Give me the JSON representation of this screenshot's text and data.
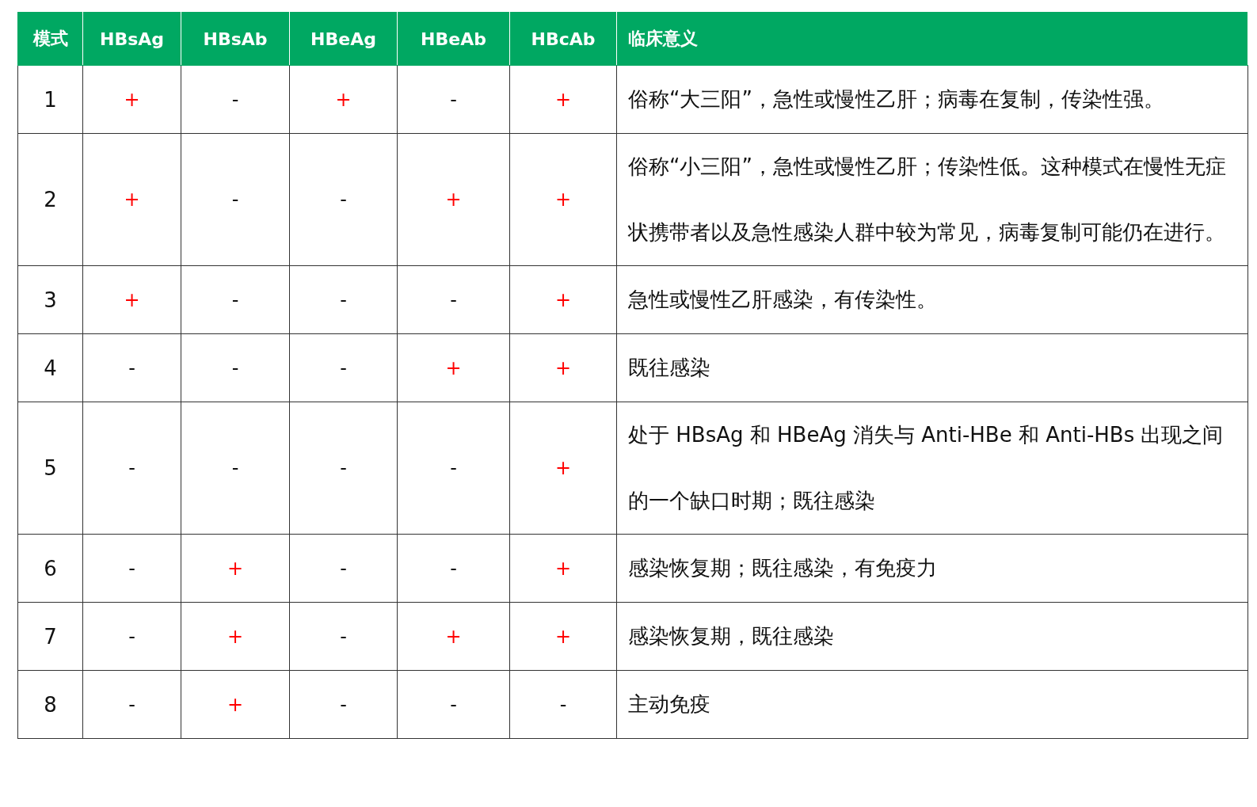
{
  "table": {
    "columns": [
      "模式",
      "HBsAg",
      "HBsAb",
      "HBeAg",
      "HBeAb",
      "HBcAb",
      "临床意义"
    ],
    "rows": [
      {
        "mode": "1",
        "marks": [
          {
            "text": "+",
            "positive": true
          },
          {
            "text": "-",
            "positive": false
          },
          {
            "text": "+",
            "positive": true
          },
          {
            "text": "-",
            "positive": false
          },
          {
            "text": "+",
            "positive": true
          }
        ],
        "meaning": "俗称“大三阳”，急性或慢性乙肝；病毒在复制，传染性强。"
      },
      {
        "mode": "2",
        "marks": [
          {
            "text": "+",
            "positive": true
          },
          {
            "text": "-",
            "positive": false
          },
          {
            "text": "-",
            "positive": false
          },
          {
            "text": "+",
            "positive": true
          },
          {
            "text": "+",
            "positive": true
          }
        ],
        "meaning": "俗称“小三阳”，急性或慢性乙肝；传染性低。这种模式在慢性无症状携带者以及急性感染人群中较为常见，病毒复制可能仍在进行。"
      },
      {
        "mode": "3",
        "marks": [
          {
            "text": "+",
            "positive": true
          },
          {
            "text": "-",
            "positive": false
          },
          {
            "text": "-",
            "positive": false
          },
          {
            "text": "-",
            "positive": false
          },
          {
            "text": "+",
            "positive": true
          }
        ],
        "meaning": "急性或慢性乙肝感染，有传染性。"
      },
      {
        "mode": "4",
        "marks": [
          {
            "text": "-",
            "positive": false
          },
          {
            "text": "-",
            "positive": false
          },
          {
            "text": "-",
            "positive": false
          },
          {
            "text": "+",
            "positive": true
          },
          {
            "text": "+",
            "positive": true
          }
        ],
        "meaning": "既往感染"
      },
      {
        "mode": "5",
        "marks": [
          {
            "text": "-",
            "positive": false
          },
          {
            "text": "-",
            "positive": false
          },
          {
            "text": "-",
            "positive": false
          },
          {
            "text": "-",
            "positive": false
          },
          {
            "text": "+",
            "positive": true
          }
        ],
        "meaning": "处于 HBsAg 和 HBeAg 消失与 Anti-HBe 和 Anti-HBs 出现之间的一个缺口时期；既往感染"
      },
      {
        "mode": "6",
        "marks": [
          {
            "text": "-",
            "positive": false
          },
          {
            "text": "+",
            "positive": true
          },
          {
            "text": "-",
            "positive": false
          },
          {
            "text": "-",
            "positive": false
          },
          {
            "text": "+",
            "positive": true
          }
        ],
        "meaning": "感染恢复期；既往感染，有免疫力"
      },
      {
        "mode": "7",
        "marks": [
          {
            "text": "-",
            "positive": false
          },
          {
            "text": "+",
            "positive": true
          },
          {
            "text": "-",
            "positive": false
          },
          {
            "text": "+",
            "positive": true
          },
          {
            "text": "+",
            "positive": true
          }
        ],
        "meaning": "感染恢复期，既往感染"
      },
      {
        "mode": "8",
        "marks": [
          {
            "text": "-",
            "positive": false
          },
          {
            "text": "+",
            "positive": true
          },
          {
            "text": "-",
            "positive": false
          },
          {
            "text": "-",
            "positive": false
          },
          {
            "text": "-",
            "positive": false
          }
        ],
        "meaning": "主动免疫"
      }
    ]
  }
}
